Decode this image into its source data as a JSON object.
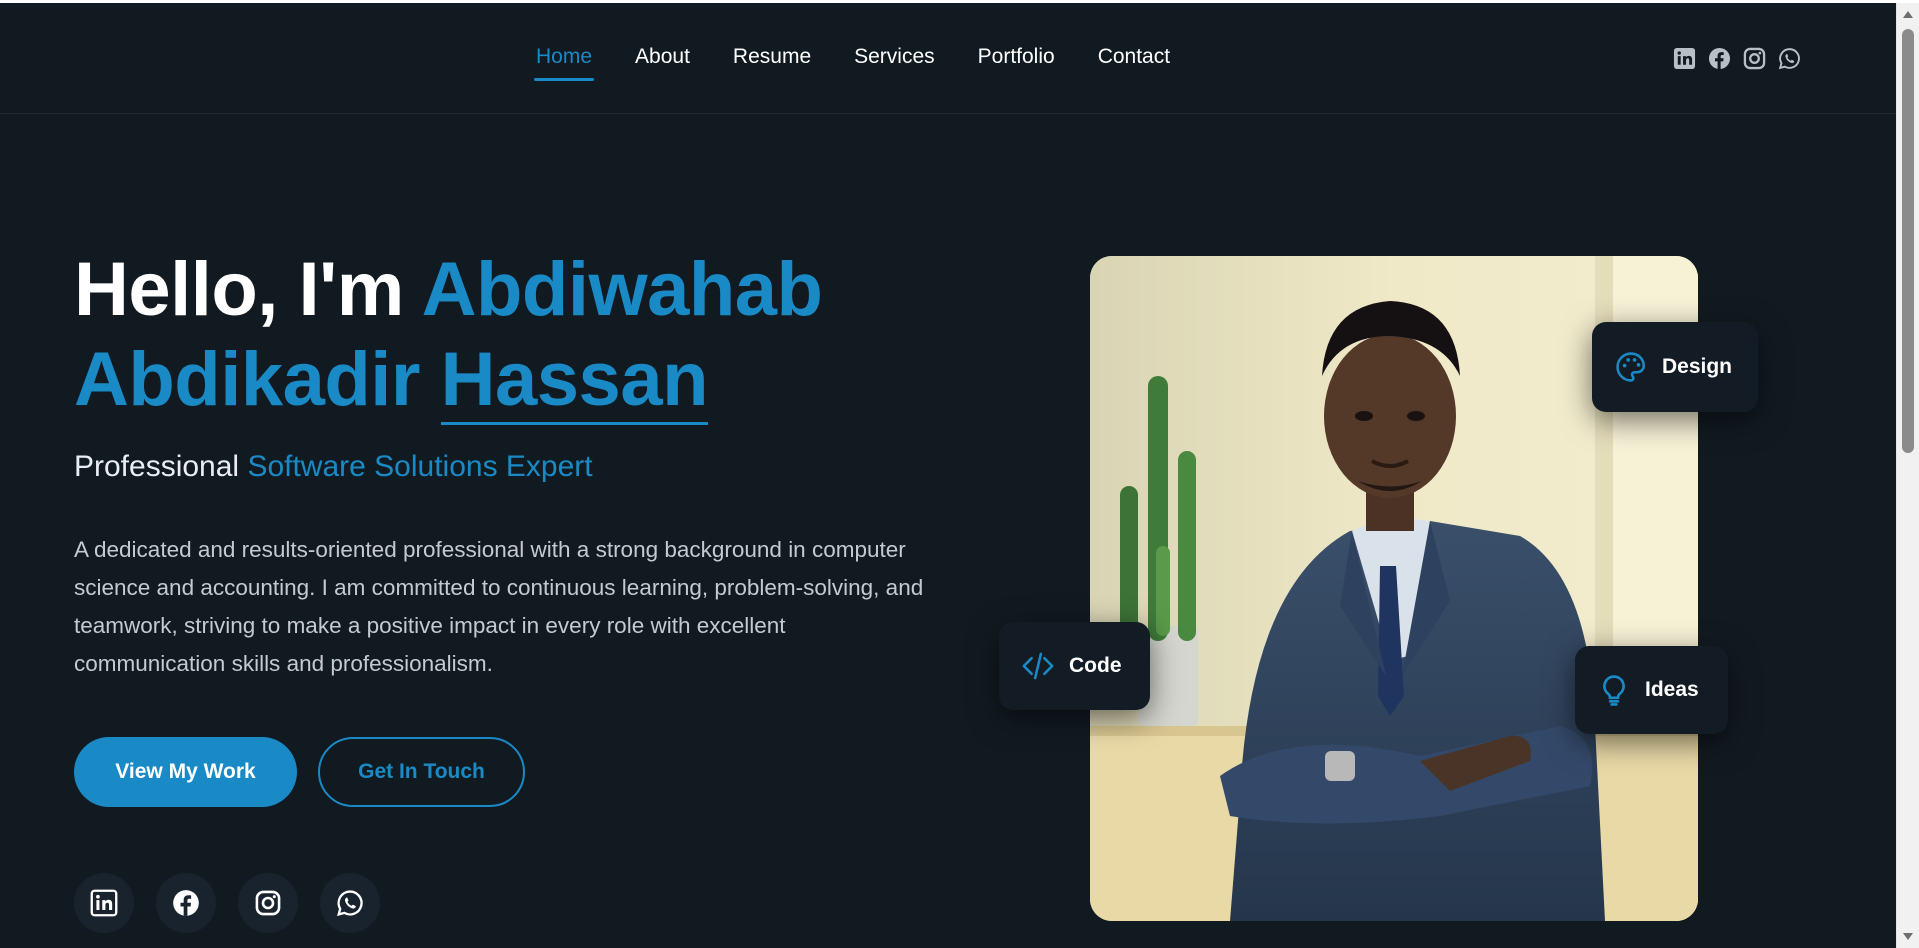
{
  "nav": {
    "items": [
      {
        "label": "Home",
        "active": true
      },
      {
        "label": "About",
        "active": false
      },
      {
        "label": "Resume",
        "active": false
      },
      {
        "label": "Services",
        "active": false
      },
      {
        "label": "Portfolio",
        "active": false
      },
      {
        "label": "Contact",
        "active": false
      }
    ]
  },
  "header_social": [
    "linkedin-icon",
    "facebook-icon",
    "instagram-icon",
    "whatsapp-icon"
  ],
  "hero": {
    "greeting": "Hello, I'm",
    "first_name": "Abdiwahab",
    "middle_name": "Abdikadir",
    "last_name": "Hassan",
    "subtitle_prefix": "Professional",
    "subtitle_accent": "Software Solutions Expert",
    "description": "A dedicated and results-oriented professional with a strong background in computer science and accounting. I am committed to continuous learning, problem-solving, and teamwork, striving to make a positive impact in every role with excellent communication skills and professionalism.",
    "primary_button": "View My Work",
    "secondary_button": "Get In Touch"
  },
  "social_buttons": [
    "linkedin-icon",
    "facebook-icon",
    "instagram-icon",
    "whatsapp-icon"
  ],
  "badges": {
    "design": "Design",
    "code": "Code",
    "ideas": "Ideas"
  },
  "colors": {
    "background": "#121a21",
    "accent": "#1a8ac6",
    "text": "#ffffff",
    "muted_text": "#c4cad0"
  }
}
